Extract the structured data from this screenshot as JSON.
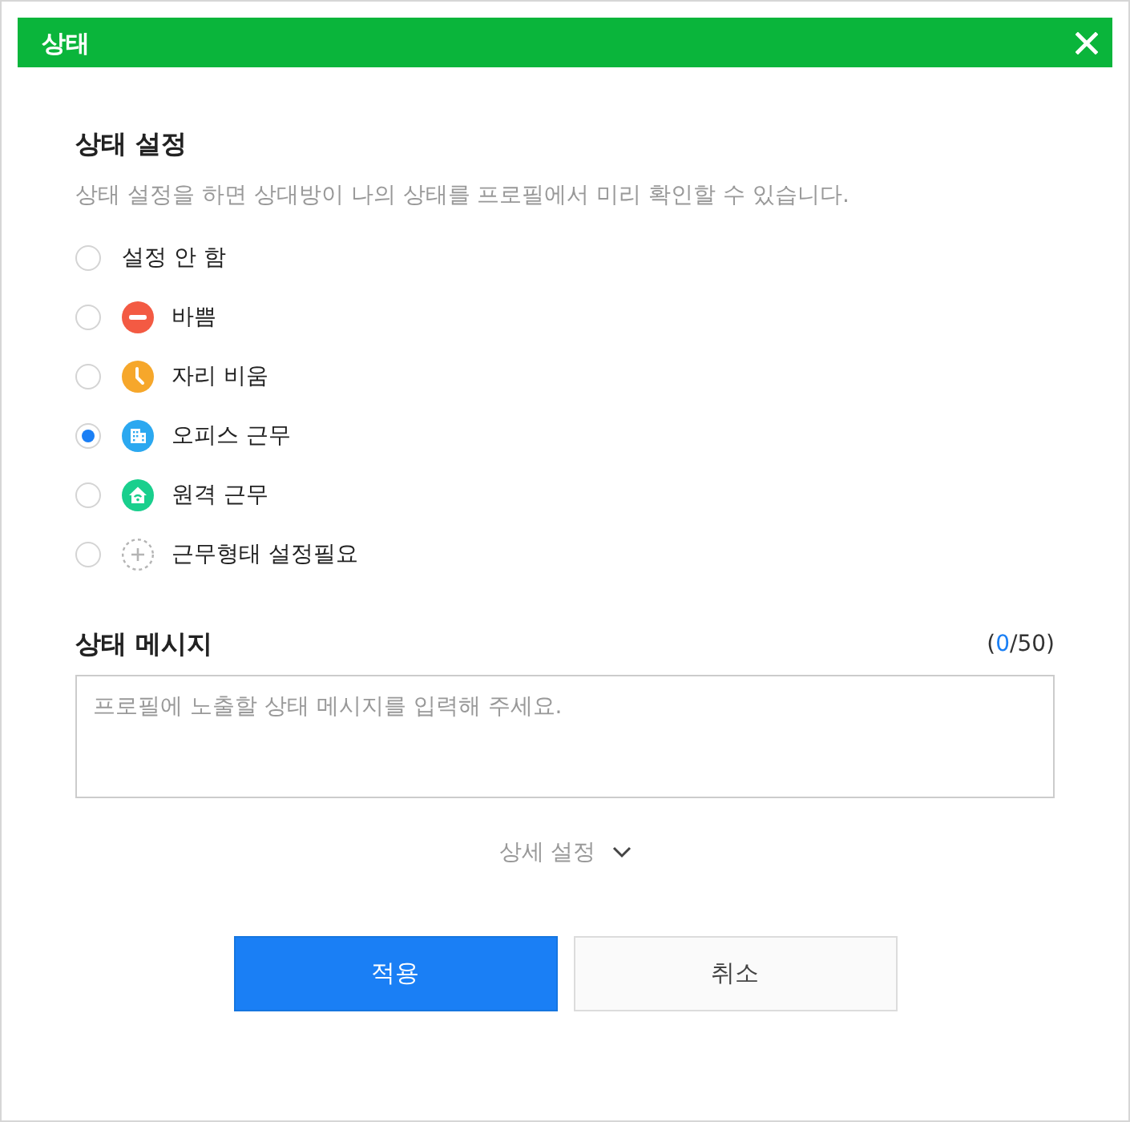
{
  "window": {
    "title": "상태"
  },
  "status_section": {
    "title": "상태 설정",
    "description": "상태 설정을 하면 상대방이 나의 상태를 프로필에서 미리 확인할 수 있습니다.",
    "options": [
      {
        "label": "설정 안 함",
        "kind": "none",
        "selected": false
      },
      {
        "label": "바쁨",
        "kind": "busy",
        "color": "#f35a43",
        "selected": false
      },
      {
        "label": "자리 비움",
        "kind": "away",
        "color": "#f6a72b",
        "selected": false
      },
      {
        "label": "오피스 근무",
        "kind": "office",
        "color": "#2ba8f0",
        "selected": true
      },
      {
        "label": "원격 근무",
        "kind": "remote",
        "color": "#19cf8d",
        "selected": false
      },
      {
        "label": "근무형태 설정필요",
        "kind": "unset",
        "color": "#b4b4b4",
        "selected": false
      }
    ]
  },
  "message_section": {
    "title": "상태 메시지",
    "counter": {
      "open": "(",
      "count": "0",
      "rest": "/50)"
    },
    "placeholder": "프로필에 노출할 상태 메시지를 입력해 주세요."
  },
  "details_toggle": {
    "label": "상세 설정",
    "expanded": false
  },
  "buttons": [
    {
      "label": "적용",
      "kind": "primary"
    },
    {
      "label": "취소",
      "kind": "secondary"
    }
  ]
}
